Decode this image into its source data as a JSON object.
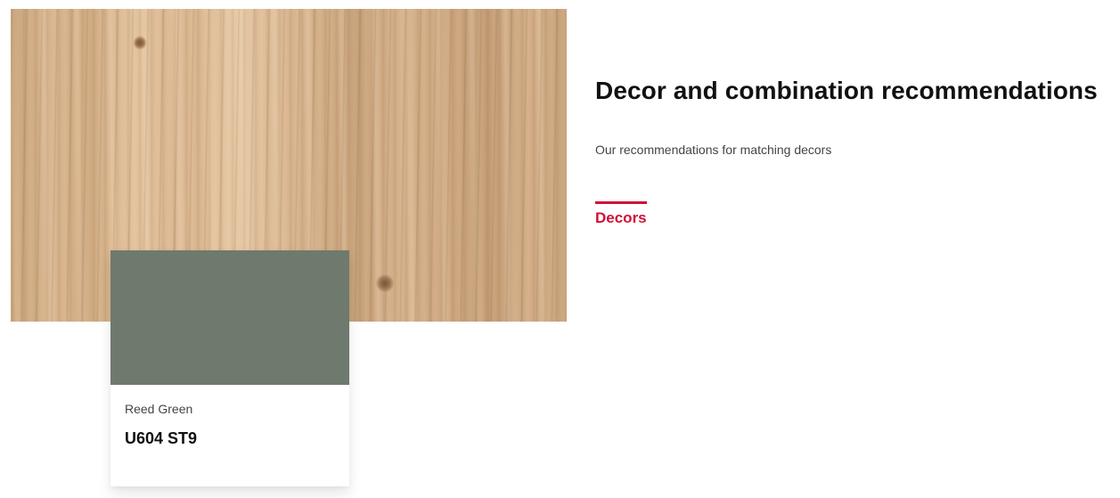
{
  "section": {
    "title": "Decor and combination recommendations",
    "subtitle": "Our recommendations for matching decors",
    "tabs": [
      {
        "label": "Decors",
        "active": true
      }
    ]
  },
  "decor_card": {
    "name": "Reed Green",
    "code": "U604 ST9",
    "swatch_color": "#6e7a6d"
  },
  "colors": {
    "accent": "#d0103a",
    "heading": "#111111",
    "body_text": "#444444"
  }
}
